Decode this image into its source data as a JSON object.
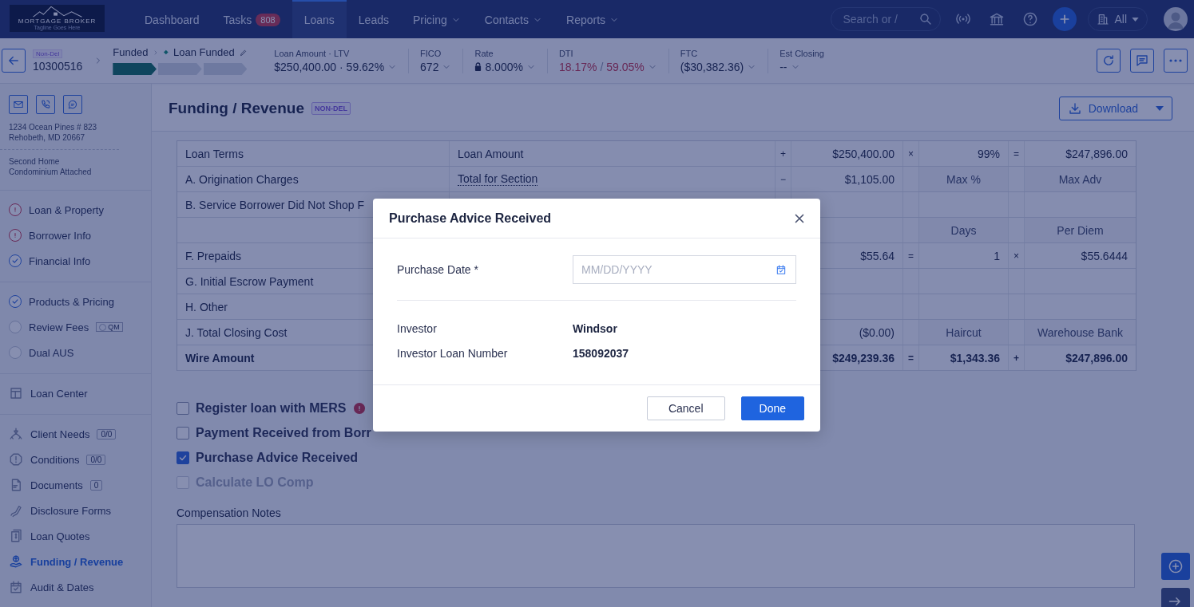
{
  "nav": {
    "logo": {
      "name": "MORTGAGE BROKER",
      "tagline": "Tagline Goes Here"
    },
    "items": [
      {
        "label": "Dashboard",
        "selected": false,
        "dropdown": false
      },
      {
        "label": "Tasks",
        "badge": "808",
        "selected": false,
        "dropdown": false
      },
      {
        "label": "Loans",
        "selected": true,
        "dropdown": false
      },
      {
        "label": "Leads",
        "selected": false,
        "dropdown": false
      },
      {
        "label": "Pricing",
        "selected": false,
        "dropdown": true
      },
      {
        "label": "Contacts",
        "selected": false,
        "dropdown": true
      },
      {
        "label": "Reports",
        "selected": false,
        "dropdown": true
      }
    ],
    "search": {
      "placeholder": "Search or /"
    },
    "scope": {
      "value": "All"
    }
  },
  "loan_bar": {
    "channel": "Non-Del",
    "number": "10300516",
    "stage": "Funded",
    "status": "Loan Funded",
    "progress": [
      {
        "done": true
      },
      {
        "done": false
      },
      {
        "done": false
      }
    ],
    "metrics": [
      {
        "label": "Loan Amount · LTV",
        "values": [
          "$250,400.00 · 59.62%"
        ],
        "locked": false,
        "alert": false
      },
      {
        "label": "FICO",
        "values": [
          "672"
        ],
        "locked": false,
        "alert": false
      },
      {
        "label": "Rate",
        "values": [
          "8.000%"
        ],
        "locked": true,
        "alert": false
      },
      {
        "label": "DTI",
        "values": [
          "18.17%",
          "59.05%"
        ],
        "separator": "/",
        "locked": false,
        "alert": true
      },
      {
        "label": "FTC",
        "values": [
          "($30,382.36)"
        ],
        "locked": false,
        "alert": false
      },
      {
        "label": "Est Closing",
        "values": [
          "--"
        ],
        "locked": false,
        "alert": false
      }
    ]
  },
  "sidebar": {
    "address": [
      "1234 Ocean Pines # 823",
      "Rehobeth, MD 20667"
    ],
    "property": [
      "Second Home",
      "Condominium Attached"
    ],
    "groups": [
      {
        "kind": "steps",
        "items": [
          {
            "label": "Loan & Property",
            "kind": "error"
          },
          {
            "label": "Borrower Info",
            "kind": "error"
          },
          {
            "label": "Financial Info",
            "kind": "done"
          }
        ]
      },
      {
        "kind": "steps",
        "items": [
          {
            "label": "Products & Pricing",
            "kind": "done"
          },
          {
            "label": "Review Fees",
            "kind": "pending",
            "tag": "QM"
          },
          {
            "label": "Dual AUS",
            "kind": "pending"
          }
        ]
      },
      {
        "kind": "links",
        "items": [
          {
            "label": "Loan Center",
            "selected": false
          }
        ]
      },
      {
        "kind": "links",
        "items": [
          {
            "label": "Client Needs",
            "badge": "0/0",
            "selected": false
          },
          {
            "label": "Conditions",
            "badge": "0/0",
            "selected": false
          },
          {
            "label": "Documents",
            "badge": "0",
            "selected": false
          },
          {
            "label": "Disclosure Forms",
            "selected": false
          },
          {
            "label": "Loan Quotes",
            "selected": false
          },
          {
            "label": "Funding / Revenue",
            "selected": true
          },
          {
            "label": "Audit & Dates",
            "selected": false
          }
        ]
      }
    ]
  },
  "page": {
    "title": "Funding / Revenue",
    "badge": "NON-DEL",
    "download": "Download"
  },
  "table": {
    "rows": [
      {
        "kind": "figures",
        "label": "Loan Terms",
        "note": "Loan Amount",
        "note_link": false,
        "op_a": "+",
        "amount": "$250,400.00",
        "op_b": "×",
        "factor": "99%",
        "op_c": "=",
        "result": "$247,896.00",
        "bold": false
      },
      {
        "kind": "captions",
        "label": "A. Origination Charges",
        "note": "Total for Section",
        "note_link": true,
        "op_a": "−",
        "amount": "$1,105.00",
        "factor": "Max %",
        "result": "Max Adv",
        "bold": false
      },
      {
        "kind": "figures",
        "label": "B. Service Borrower Did Not Shop F",
        "bold": false
      },
      {
        "kind": "captions",
        "factor": "Days",
        "result": "Per Diem",
        "bold": false
      },
      {
        "kind": "figures",
        "label": "F. Prepaids",
        "amount": "$55.64",
        "op_b": "=",
        "factor": "1",
        "op_c": "×",
        "result": "$55.6444",
        "bold": false
      },
      {
        "kind": "figures",
        "label": "G. Initial Escrow Payment",
        "bold": false
      },
      {
        "kind": "figures",
        "label": "H. Other",
        "bold": false
      },
      {
        "kind": "captions",
        "label": "J. Total Closing Cost",
        "amount": "($0.00)",
        "factor": "Haircut",
        "result": "Warehouse Bank",
        "bold": false
      },
      {
        "kind": "figures",
        "label": "Wire Amount",
        "amount": "$249,239.36",
        "op_b": "=",
        "factor": "$1,343.36",
        "op_c": "+",
        "result": "$247,896.00",
        "bold": true
      }
    ]
  },
  "options": [
    {
      "label": "Register loan with MERS",
      "checked": false,
      "disabled": false,
      "warning": true
    },
    {
      "label": "Payment Received from Borr",
      "checked": false,
      "disabled": false,
      "warning": false
    },
    {
      "label": "Purchase Advice Received",
      "checked": true,
      "disabled": false,
      "warning": false
    },
    {
      "label": "Calculate LO Comp",
      "checked": false,
      "disabled": true,
      "warning": false
    }
  ],
  "notes": {
    "label": "Compensation Notes"
  },
  "modal": {
    "title": "Purchase Advice Received",
    "date_label": "Purchase Date *",
    "date_placeholder": "MM/DD/YYYY",
    "fields": [
      {
        "label": "Investor",
        "value": "Windsor"
      },
      {
        "label": "Investor Loan Number",
        "value": "158092037"
      }
    ],
    "buttons": [
      {
        "label": "Cancel",
        "kind": "secondary"
      },
      {
        "label": "Done",
        "kind": "primary"
      }
    ]
  }
}
